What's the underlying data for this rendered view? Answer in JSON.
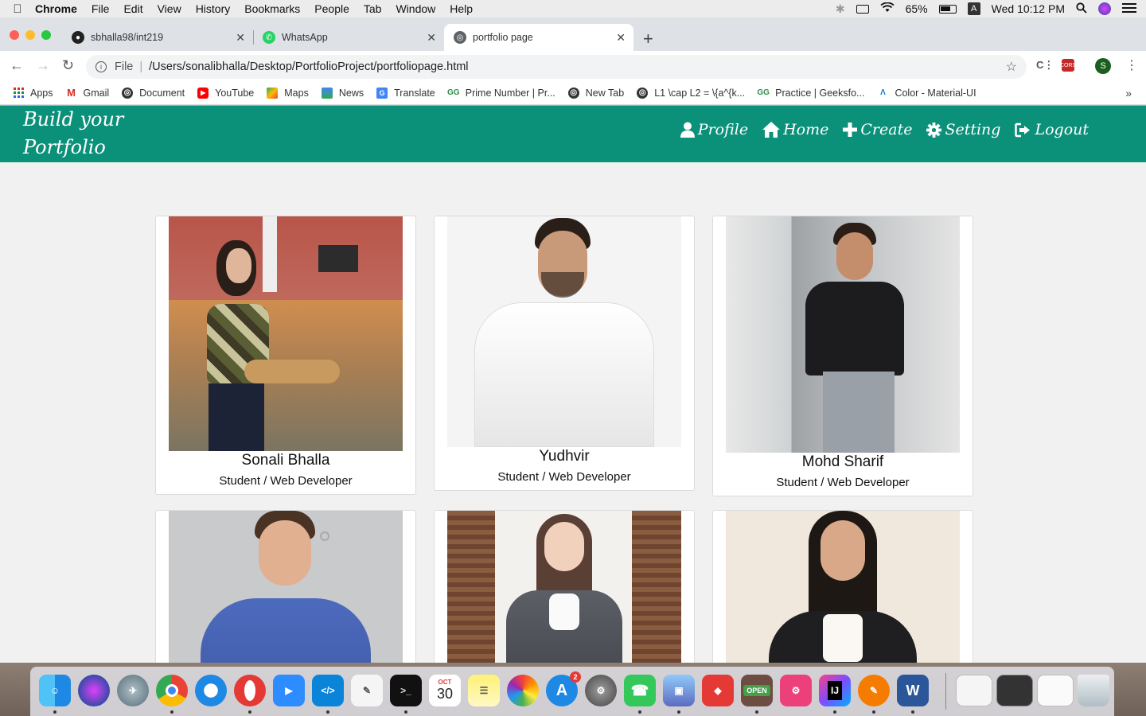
{
  "menubar": {
    "app": "Chrome",
    "items": [
      "File",
      "Edit",
      "View",
      "History",
      "Bookmarks",
      "People",
      "Tab",
      "Window",
      "Help"
    ],
    "battery": "65%",
    "input_source": "A",
    "clock": "Wed 10:12 PM"
  },
  "tabs": [
    {
      "title": "sbhalla98/int219",
      "icon": "github-icon"
    },
    {
      "title": "WhatsApp",
      "icon": "whatsapp-icon"
    },
    {
      "title": "portfolio page",
      "icon": "globe-icon",
      "active": true
    }
  ],
  "omnibox": {
    "scheme": "File",
    "url": "/Users/sonalibhalla/Desktop/PortfolioProject/portfoliopage.html"
  },
  "profile_initial": "S",
  "bookmarks": [
    {
      "label": "Apps",
      "icon": "apps-grid-icon"
    },
    {
      "label": "Gmail",
      "icon": "gmail-icon"
    },
    {
      "label": "Document",
      "icon": "globe-icon"
    },
    {
      "label": "YouTube",
      "icon": "youtube-icon"
    },
    {
      "label": "Maps",
      "icon": "maps-icon"
    },
    {
      "label": "News",
      "icon": "news-icon"
    },
    {
      "label": "Translate",
      "icon": "translate-icon"
    },
    {
      "label": "Prime Number | Pr...",
      "icon": "geeksforgeeks-icon"
    },
    {
      "label": "New Tab",
      "icon": "globe-icon"
    },
    {
      "label": "L1 \\cap L2 = \\{a^{k...",
      "icon": "globe-icon"
    },
    {
      "label": "Practice | Geeksfo...",
      "icon": "geeksforgeeks-icon"
    },
    {
      "label": "Color - Material-UI",
      "icon": "material-ui-icon"
    }
  ],
  "site": {
    "brand_line1": "Build your",
    "brand_line2": "Portfolio",
    "nav": [
      {
        "label": "Profile",
        "icon": "user-icon"
      },
      {
        "label": "Home",
        "icon": "home-icon"
      },
      {
        "label": "Create",
        "icon": "plus-icon"
      },
      {
        "label": "Setting",
        "icon": "gear-icon"
      },
      {
        "label": "Logout",
        "icon": "logout-icon"
      }
    ],
    "profiles": [
      {
        "name": "Sonali Bhalla",
        "role": "Student / Web Developer"
      },
      {
        "name": "Yudhvir",
        "role": "Student / Web Developer"
      },
      {
        "name": "Mohd Sharif",
        "role": "Student / Web Developer"
      },
      {
        "name": "",
        "role": ""
      },
      {
        "name": "",
        "role": ""
      },
      {
        "name": "",
        "role": ""
      }
    ]
  },
  "dock": {
    "apps": [
      "Finder",
      "Siri",
      "Launchpad",
      "Chrome",
      "Safari",
      "Opera",
      "Zoom",
      "VS Code",
      "TextEdit",
      "Terminal",
      "Calendar",
      "Notes",
      "Photos",
      "App Store",
      "System Preferences",
      "FaceTime",
      "Preview",
      "AnyDesk",
      "The Unarchiver",
      "Archive Utility",
      "IntelliJ IDEA",
      "Sublime",
      "Word"
    ],
    "calendar_month": "OCT",
    "calendar_day": "30",
    "appstore_badge": "2"
  }
}
